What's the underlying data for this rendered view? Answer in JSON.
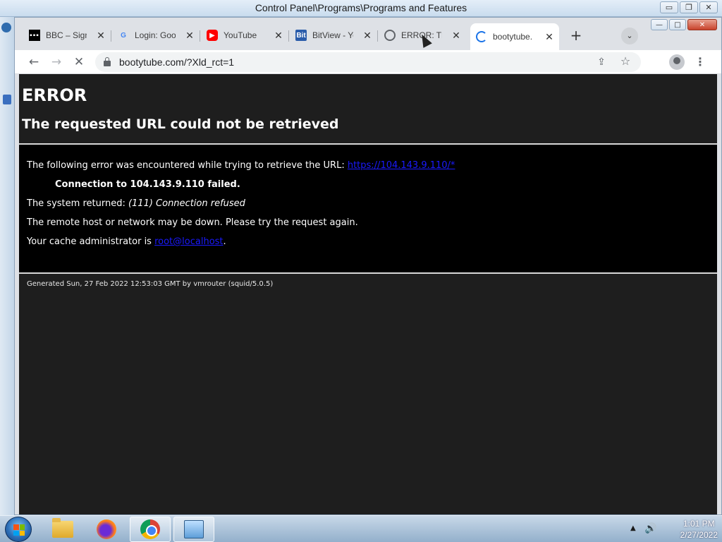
{
  "outer_window": {
    "title": "Control Panel\\Programs\\Programs and Features",
    "controls": {
      "minimize": "▭",
      "restore": "❐",
      "close": "✕"
    }
  },
  "browser": {
    "tabs": [
      {
        "label": "BBC – Sign",
        "favicon": "bbc-icon",
        "close": "✕"
      },
      {
        "label": "Login: Goo",
        "favicon": "google-icon",
        "close": "✕"
      },
      {
        "label": "YouTube",
        "favicon": "youtube-icon",
        "close": "✕"
      },
      {
        "label": "BitView - Yo",
        "favicon": "bitview-icon",
        "close": "✕"
      },
      {
        "label": "ERROR: The",
        "favicon": "globe-icon",
        "close": "✕"
      },
      {
        "label": "bootytube.",
        "favicon": "loading-spinner-icon",
        "close": "✕",
        "active": true
      }
    ],
    "new_tab_symbol": "+",
    "tab_search_symbol": "⌄",
    "window_controls": {
      "minimize": "—",
      "maximize": "□",
      "close": "✕"
    },
    "toolbar": {
      "back": "←",
      "forward": "→",
      "stop": "✕",
      "url": "bootytube.com/?Xld_rct=1",
      "share": "⇪",
      "bookmark": "☆",
      "menu": "⋮"
    }
  },
  "error_page": {
    "title": "ERROR",
    "subtitle": "The requested URL could not be retrieved",
    "intro": "The following error was encountered while trying to retrieve the URL: ",
    "intro_link": "https://104.143.9.110/*",
    "failure": "Connection to 104.143.9.110 failed.",
    "system_returned_prefix": "The system returned: ",
    "system_returned_value": "(111) Connection refused",
    "remote_down": "The remote host or network may be down. Please try the request again.",
    "admin_prefix": "Your cache administrator is ",
    "admin_link": "root@localhost",
    "admin_suffix": ".",
    "footer": "Generated Sun, 27 Feb 2022 12:53:03 GMT by vmrouter (squid/5.0.5)"
  },
  "taskbar": {
    "apps": [
      "windows-explorer",
      "firefox",
      "chrome",
      "control-panel"
    ],
    "tray": {
      "show_hidden": "▲",
      "volume": "🔊",
      "time": "1:01 PM",
      "date": "2/27/2022"
    }
  },
  "colors": {
    "page_background": "#1e1e1e",
    "error_box": "#000000",
    "link": "#1a1aff"
  }
}
